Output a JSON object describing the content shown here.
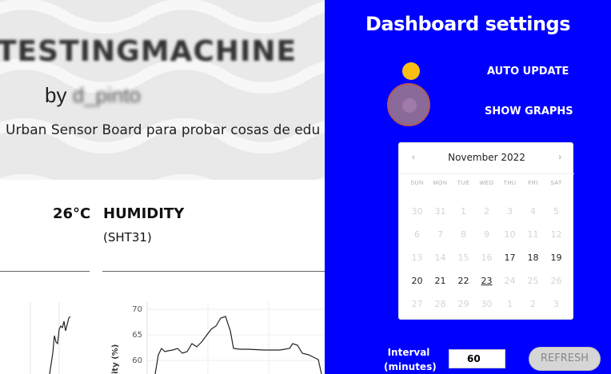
{
  "dashboard": {
    "title": "TESTINGMACHINE",
    "by_label": "by",
    "author": "d_pinto",
    "description": "Urban Sensor Board para probar cosas de edu",
    "temperature_value": "26°C",
    "humidity_title": "HUMIDITY",
    "humidity_sensor": "(SHT31)"
  },
  "chart_data": {
    "type": "line",
    "ylabel": "ity (%)",
    "yticks": [
      "70",
      "65",
      "60"
    ],
    "ylim": [
      57,
      72
    ]
  },
  "settings": {
    "title": "Dashboard settings",
    "auto_update_label": "AUTO UPDATE",
    "show_graphs_label": "SHOW GRAPHS",
    "interval_label_1": "Interval",
    "interval_label_2": "(minutes)",
    "interval_value": "60",
    "refresh_label": "REFRESH",
    "accent_color": "#0000ff",
    "toggle_color": "#fbbf14"
  },
  "calendar": {
    "month_label": "November  2022",
    "prev_icon": "‹",
    "next_icon": "›",
    "days_of_week": [
      "SUN",
      "MON",
      "TUE",
      "WED",
      "THU",
      "FRI",
      "SAT"
    ],
    "weeks": [
      [
        "30",
        "31",
        "1",
        "2",
        "3",
        "4",
        "5"
      ],
      [
        "6",
        "7",
        "8",
        "9",
        "10",
        "11",
        "12"
      ],
      [
        "13",
        "14",
        "15",
        "16",
        "17",
        "18",
        "19"
      ],
      [
        "20",
        "21",
        "22",
        "23",
        "24",
        "25",
        "26"
      ],
      [
        "27",
        "28",
        "29",
        "30",
        "1",
        "2",
        "3"
      ]
    ],
    "enabled_days": [
      "17",
      "18",
      "19",
      "20",
      "21",
      "22",
      "23"
    ],
    "today": "23"
  }
}
